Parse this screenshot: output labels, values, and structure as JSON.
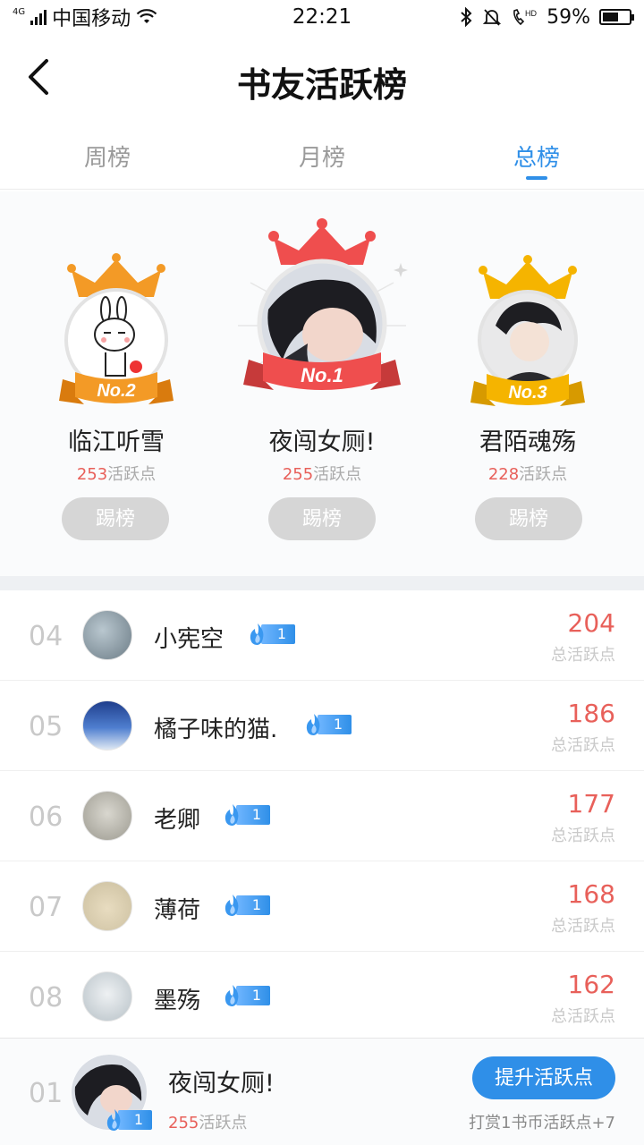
{
  "status_bar": {
    "network_type": "4G",
    "carrier": "中国移动",
    "time": "22:21",
    "battery_percent": "59%",
    "battery_level": 0.59,
    "icons": [
      "bluetooth-icon",
      "mute-bell-icon",
      "hd-call-icon"
    ]
  },
  "header": {
    "title": "书友活跃榜",
    "back_icon": "back-arrow-icon"
  },
  "tabs": [
    {
      "label": "周榜",
      "active": false
    },
    {
      "label": "月榜",
      "active": false
    },
    {
      "label": "总榜",
      "active": true
    }
  ],
  "podium": {
    "first": {
      "badge": "No.1",
      "name": "夜闯女厕!",
      "points": "255",
      "points_suffix": "活跃点",
      "button": "踢榜",
      "color": "#ef4e4e"
    },
    "second": {
      "badge": "No.2",
      "name": "临江听雪",
      "points": "253",
      "points_suffix": "活跃点",
      "button": "踢榜",
      "color": "#f39a26"
    },
    "third": {
      "badge": "No.3",
      "name": "君陌魂殇",
      "points": "228",
      "points_suffix": "活跃点",
      "button": "踢榜",
      "color": "#f5b400"
    }
  },
  "ranking": [
    {
      "rank": "04",
      "name": "小宪空",
      "level": "1",
      "score": "204",
      "score_label": "总活跃点"
    },
    {
      "rank": "05",
      "name": "橘子味的猫.",
      "level": "1",
      "score": "186",
      "score_label": "总活跃点"
    },
    {
      "rank": "06",
      "name": "老卿",
      "level": "1",
      "score": "177",
      "score_label": "总活跃点"
    },
    {
      "rank": "07",
      "name": "薄荷",
      "level": "1",
      "score": "168",
      "score_label": "总活跃点"
    },
    {
      "rank": "08",
      "name": "墨殇",
      "level": "1",
      "score": "162",
      "score_label": "总活跃点"
    }
  ],
  "self": {
    "rank": "01",
    "name": "夜闯女厕!",
    "level": "1",
    "points": "255",
    "points_suffix": "活跃点",
    "button": "提升活跃点",
    "hint": "打赏1书币活跃点+7"
  },
  "colors": {
    "accent": "#2f8fe8",
    "score_red": "#e8605a",
    "muted": "#c9c9c9"
  }
}
